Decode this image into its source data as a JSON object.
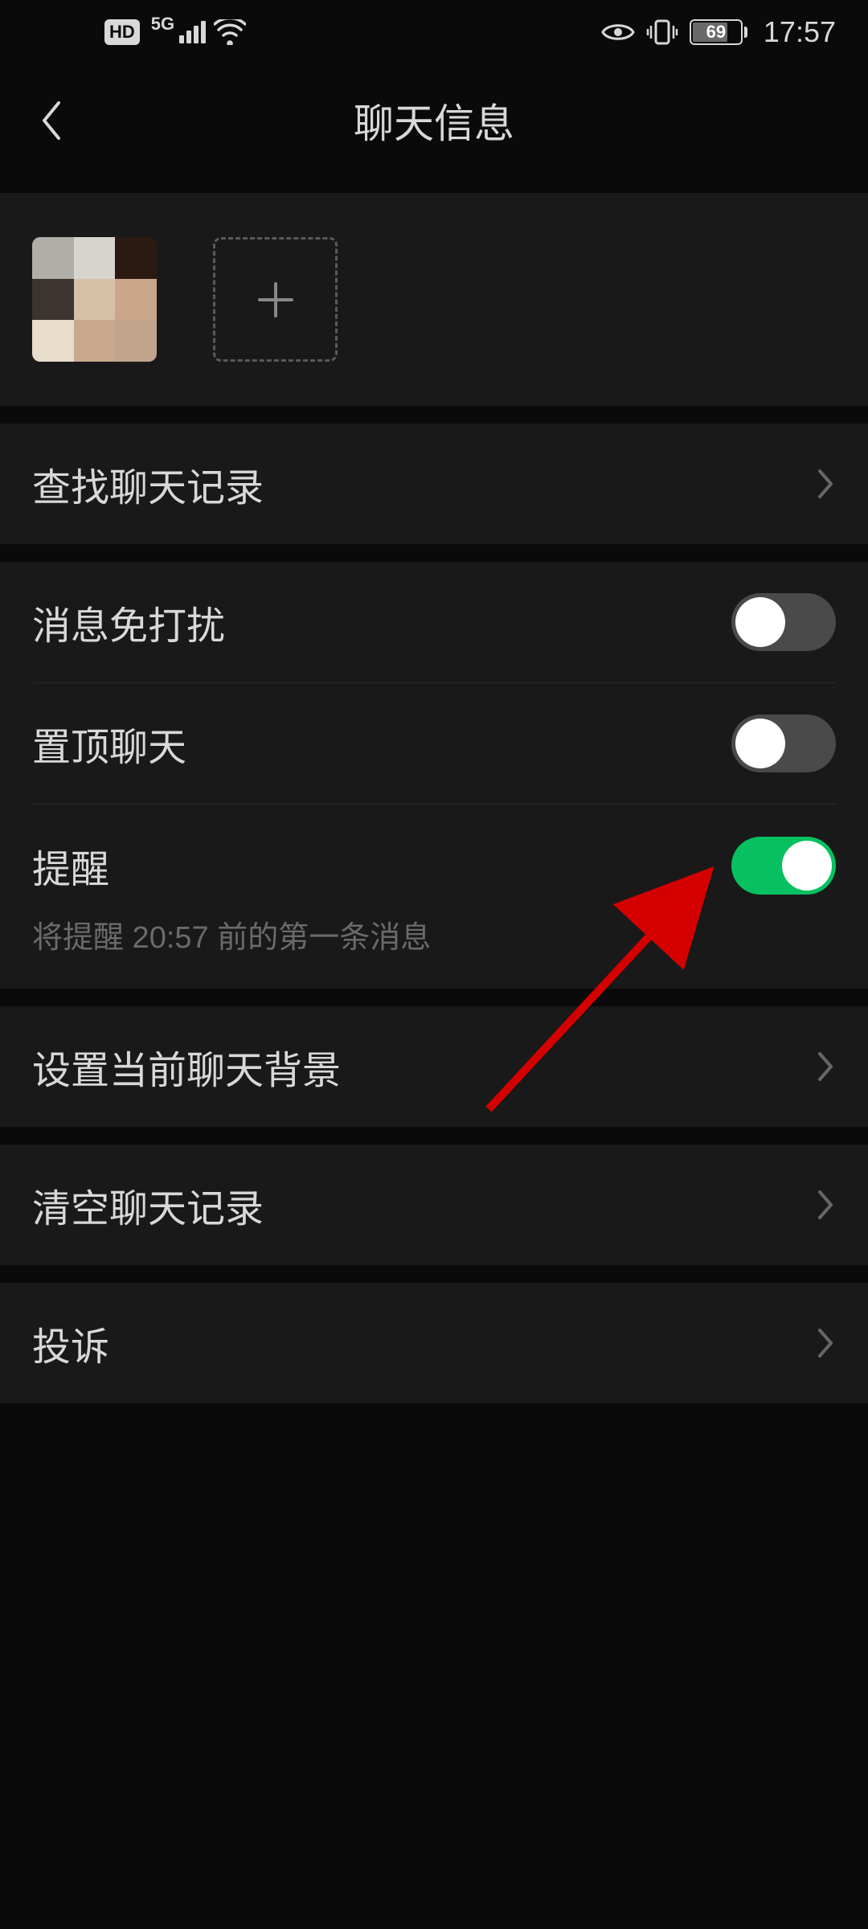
{
  "status_bar": {
    "hd": "HD",
    "network": "5G",
    "battery": "69",
    "time": "17:57"
  },
  "header": {
    "title": "聊天信息"
  },
  "rows": {
    "search_history": "查找聊天记录",
    "mute": "消息免打扰",
    "pin": "置顶聊天",
    "remind": "提醒",
    "remind_sub": "将提醒 20:57 前的第一条消息",
    "background": "设置当前聊天背景",
    "clear": "清空聊天记录",
    "report": "投诉"
  },
  "toggles": {
    "mute": false,
    "pin": false,
    "remind": true
  }
}
